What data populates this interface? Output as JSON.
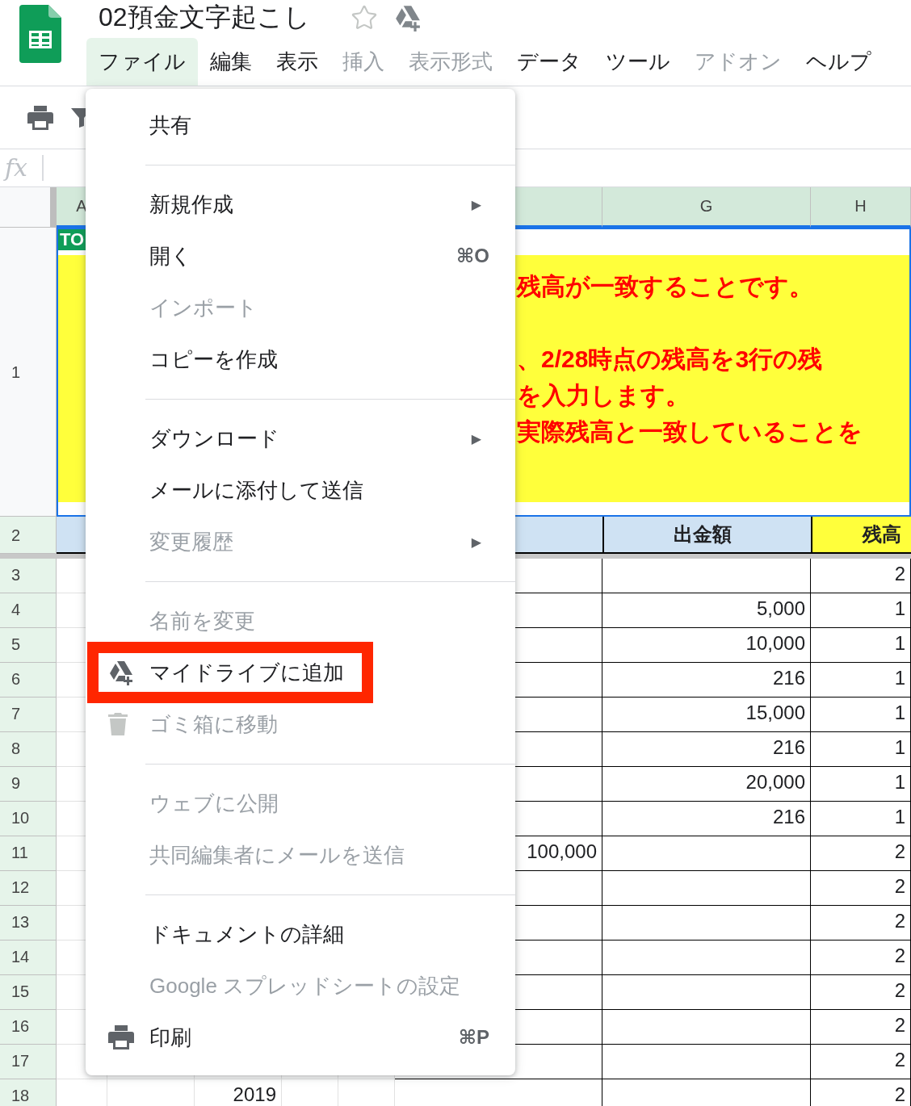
{
  "app": {
    "title": "02預金文字起こし"
  },
  "menubar": [
    {
      "label": "ファイル",
      "selected": true,
      "disabled": false
    },
    {
      "label": "編集",
      "selected": false,
      "disabled": false
    },
    {
      "label": "表示",
      "selected": false,
      "disabled": false
    },
    {
      "label": "挿入",
      "selected": false,
      "disabled": true
    },
    {
      "label": "表示形式",
      "selected": false,
      "disabled": true
    },
    {
      "label": "データ",
      "selected": false,
      "disabled": false
    },
    {
      "label": "ツール",
      "selected": false,
      "disabled": false
    },
    {
      "label": "アドオン",
      "selected": false,
      "disabled": true
    },
    {
      "label": "ヘルプ",
      "selected": false,
      "disabled": false
    }
  ],
  "file_menu": {
    "items": [
      {
        "kind": "plain",
        "label": "共有",
        "disabled": false,
        "highlighted": false
      },
      {
        "kind": "divider"
      },
      {
        "kind": "plain",
        "label": "新規作成",
        "arrow": "▶",
        "disabled": false,
        "highlighted": false
      },
      {
        "kind": "plain",
        "label": "開く",
        "shortcut": "⌘O",
        "disabled": false,
        "highlighted": false
      },
      {
        "kind": "plain",
        "label": "インポート",
        "disabled": true,
        "highlighted": false
      },
      {
        "kind": "plain",
        "label": "コピーを作成",
        "disabled": false,
        "highlighted": false
      },
      {
        "kind": "divider"
      },
      {
        "kind": "plain",
        "label": "ダウンロード",
        "arrow": "▶",
        "disabled": false,
        "highlighted": false
      },
      {
        "kind": "plain",
        "label": "メールに添付して送信",
        "disabled": false,
        "highlighted": false
      },
      {
        "kind": "plain",
        "label": "変更履歴",
        "arrow": "▶",
        "disabled": true,
        "highlighted": false
      },
      {
        "kind": "divider"
      },
      {
        "kind": "plain",
        "label": "名前を変更",
        "disabled": true,
        "highlighted": false
      },
      {
        "kind": "drive",
        "label": "マイドライブに追加",
        "disabled": false,
        "highlighted": true
      },
      {
        "kind": "trash",
        "label": "ゴミ箱に移動",
        "disabled": true,
        "highlighted": false
      },
      {
        "kind": "divider"
      },
      {
        "kind": "plain",
        "label": "ウェブに公開",
        "disabled": true,
        "highlighted": false
      },
      {
        "kind": "plain",
        "label": "共同編集者にメールを送信",
        "disabled": true,
        "highlighted": false
      },
      {
        "kind": "divider"
      },
      {
        "kind": "plain",
        "label": "ドキュメントの詳細",
        "disabled": false,
        "highlighted": false
      },
      {
        "kind": "plain",
        "label": "Google スプレッドシートの設定",
        "disabled": true,
        "highlighted": false
      },
      {
        "kind": "print",
        "label": "印刷",
        "shortcut": "⌘P",
        "disabled": false,
        "highlighted": false
      }
    ]
  },
  "sheet": {
    "formula_label": "fx",
    "column_headers": {
      "A": "A",
      "G": "G",
      "H": "H"
    },
    "rows": [
      {
        "kind": "banner",
        "number": "1",
        "selected": false,
        "tag": "TO",
        "lines": [
          "残高が一致することです。",
          "、2/28時点の残高を3行の残",
          "を入力します。",
          "実際残高と一致していることを"
        ]
      },
      {
        "kind": "header",
        "number": "2",
        "selected": true,
        "G": "出金額",
        "H": "残高"
      },
      {
        "kind": "data",
        "number": "3",
        "selected": true,
        "H": "2"
      },
      {
        "kind": "data",
        "number": "4",
        "selected": true,
        "G": "5,000",
        "H": "1"
      },
      {
        "kind": "data",
        "number": "5",
        "selected": true,
        "G": "10,000",
        "H": "1"
      },
      {
        "kind": "data",
        "number": "6",
        "selected": true,
        "G": "216",
        "H": "1"
      },
      {
        "kind": "data",
        "number": "7",
        "selected": true,
        "G": "15,000",
        "H": "1"
      },
      {
        "kind": "data",
        "number": "8",
        "selected": true,
        "G": "216",
        "H": "1"
      },
      {
        "kind": "data",
        "number": "9",
        "selected": true,
        "G": "20,000",
        "H": "1"
      },
      {
        "kind": "data",
        "number": "10",
        "selected": true,
        "G": "216",
        "H": "1"
      },
      {
        "kind": "data",
        "number": "11",
        "selected": true,
        "F": "100,000",
        "H": "2"
      },
      {
        "kind": "data",
        "number": "12",
        "selected": true,
        "H": "2"
      },
      {
        "kind": "data",
        "number": "13",
        "selected": true,
        "H": "2"
      },
      {
        "kind": "data",
        "number": "14",
        "selected": true,
        "H": "2"
      },
      {
        "kind": "data",
        "number": "15",
        "selected": true,
        "H": "2"
      },
      {
        "kind": "data",
        "number": "16",
        "selected": true,
        "H": "2"
      },
      {
        "kind": "data",
        "number": "17",
        "selected": true,
        "H": "2"
      },
      {
        "kind": "data",
        "number": "18",
        "selected": true,
        "C": "2019",
        "H": "2"
      }
    ]
  }
}
